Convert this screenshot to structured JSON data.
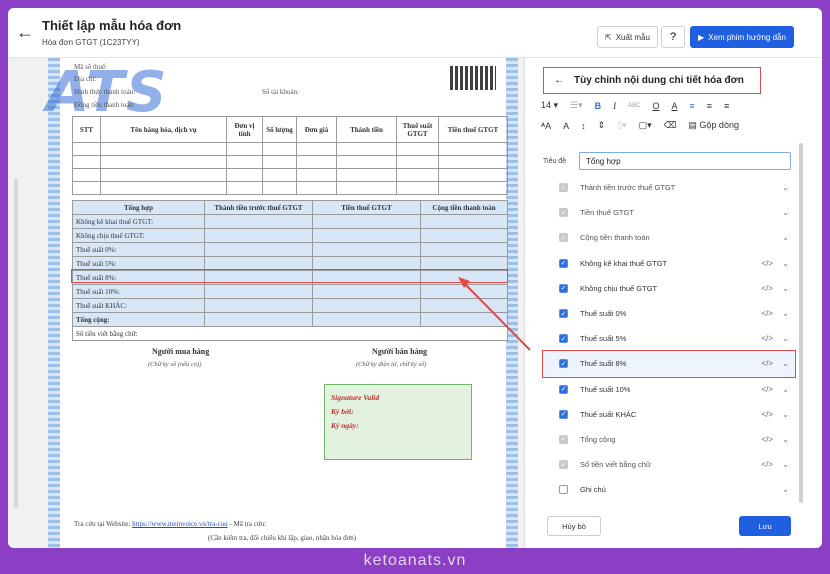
{
  "header": {
    "title": "Thiết lập mẫu hóa đơn",
    "subtitle": "Hóa đơn GTGT (1C23TYY)",
    "export_label": "Xuất mẫu",
    "help_label": "?",
    "video_label": "Xem phim hướng dẫn"
  },
  "invoice": {
    "logo_text": "ATS",
    "meta": {
      "tax_code": "Mã số thuế:",
      "address": "Địa chỉ:",
      "payment": "Hình thức thanh toán:",
      "account": "Số tài khoản:",
      "currency": "Đồng tiền thanh toán:"
    },
    "item_headers": [
      "STT",
      "Tên hàng hóa, dịch vụ",
      "Đơn vị tính",
      "Số lượng",
      "Đơn giá",
      "Thành tiền",
      "Thuế suất GTGT",
      "Tiền thuế GTGT"
    ],
    "summary_headers": [
      "Tổng hợp",
      "Thành tiền trước thuế GTGT",
      "Tiền thuế GTGT",
      "Cộng tiền thanh toán"
    ],
    "summary_rows": [
      "Không kê khai thuế GTGT:",
      "Không chịu thuế GTGT:",
      "Thuế suất 0%:",
      "Thuế suất 5%:",
      "Thuế suất 8%:",
      "Thuế suất 10%:",
      "Thuế suất KHÁC:",
      "Tổng cộng:",
      "Số tiền viết bằng chữ:"
    ],
    "buyer_title": "Người mua hàng",
    "buyer_sub": "(Chữ ký số (nếu có))",
    "seller_title": "Người bán hàng",
    "seller_sub": "(Chữ ký điện tử, chữ ký số)",
    "signature": {
      "valid": "Signature Valid",
      "signer": "Ký bởi:",
      "date": "Ký ngày:"
    },
    "footer_lookup": "Tra cứu tại Website:",
    "footer_link": "https://www.meinvoice.vn/tra-cuu",
    "footer_code": "- Mã tra cứu:",
    "footer_note": "(Cần kiểm tra, đối chiếu khi lập, giao, nhận hóa đơn)"
  },
  "panel": {
    "title": "Tùy chỉnh nội dung chi tiết hóa đơn",
    "font_size": "14",
    "merge_label": "Gộp dòng",
    "title_label": "Tiêu đề",
    "title_value": "Tổng hợp",
    "options": [
      {
        "label": "Thành tiền trước thuế GTGT",
        "state": "disabled",
        "code": false
      },
      {
        "label": "Tiền thuế GTGT",
        "state": "disabled",
        "code": false
      },
      {
        "label": "Cộng tiền thanh toán",
        "state": "disabled",
        "code": false
      },
      {
        "label": "Không kê khai thuế GTGT",
        "state": "checked",
        "code": true
      },
      {
        "label": "Không chịu thuế GTGT",
        "state": "checked",
        "code": true
      },
      {
        "label": "Thuế suất 0%",
        "state": "checked",
        "code": true
      },
      {
        "label": "Thuế suất 5%",
        "state": "checked",
        "code": true
      },
      {
        "label": "Thuế suất 8%",
        "state": "checked",
        "code": true,
        "selected": true
      },
      {
        "label": "Thuế suất 10%",
        "state": "checked",
        "code": true
      },
      {
        "label": "Thuế suất KHÁC",
        "state": "checked",
        "code": true
      },
      {
        "label": "Tổng cộng",
        "state": "disabled",
        "code": true
      },
      {
        "label": "Số tiền viết bằng chữ",
        "state": "disabled",
        "code": true
      },
      {
        "label": "Ghi chú",
        "state": "unchecked",
        "code": false
      }
    ],
    "cancel_label": "Hủy bỏ",
    "save_label": "Lưu"
  },
  "watermark": "ketoanats.vn",
  "colors": {
    "accent": "#1f5fe0",
    "highlight": "#e04a4a",
    "summary_bg": "#d7e7f8",
    "frame": "#8a3fc4"
  }
}
